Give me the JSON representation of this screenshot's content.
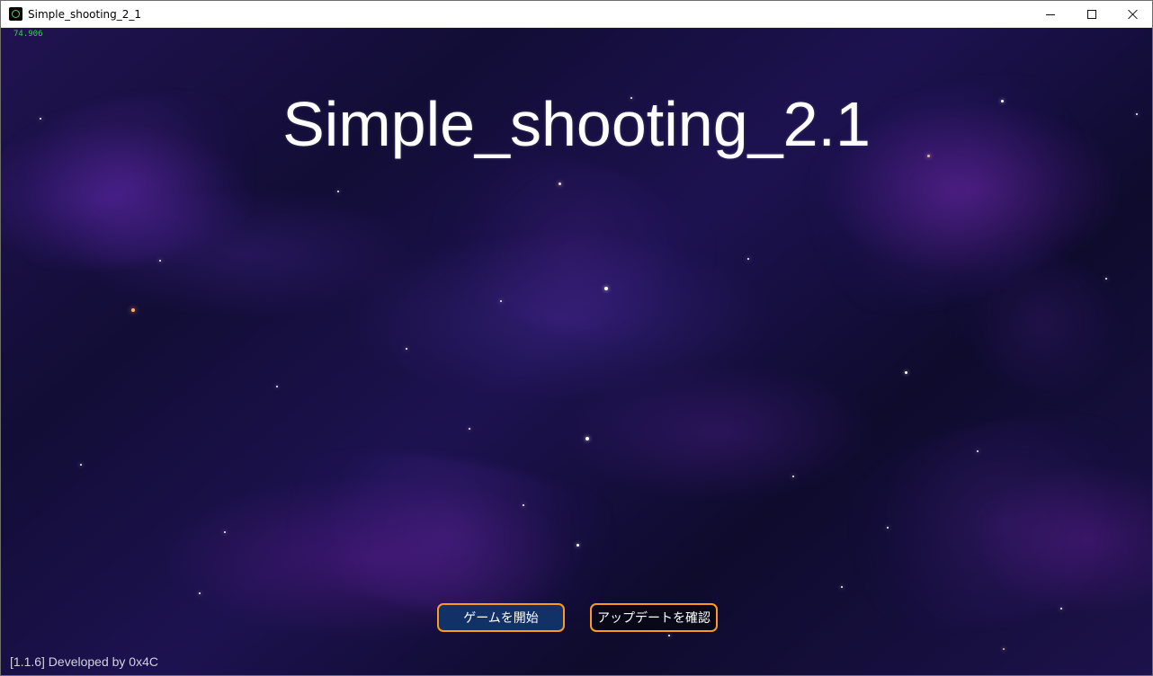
{
  "window": {
    "title": "Simple_shooting_2_1",
    "icon": "app-icon",
    "controls": {
      "minimize_icon": "minimize-icon",
      "maximize_icon": "maximize-icon",
      "close_icon": "close-icon"
    }
  },
  "game": {
    "fps": "74.906",
    "title": "Simple_shooting_2.1",
    "buttons": {
      "start_label": "ゲームを開始",
      "check_update_label": "アップデートを確認"
    },
    "footer": "[1.1.6]  Developed by 0x4C",
    "colors": {
      "fps": "#35d34f",
      "title": "#ffffff",
      "button_border": "#ff9a1f",
      "start_button_background": "#123166",
      "update_button_background": "#090818"
    }
  }
}
